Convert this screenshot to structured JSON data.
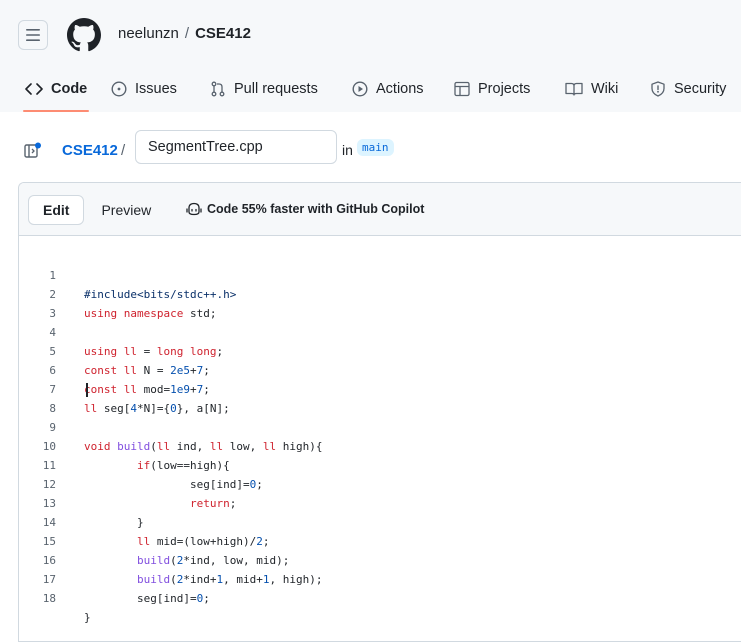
{
  "header": {
    "owner": "neelunzn",
    "separator": "/",
    "repo": "CSE412"
  },
  "tabs": [
    {
      "label": "Code",
      "icon": "code-icon",
      "selected": true
    },
    {
      "label": "Issues",
      "icon": "issue-opened-icon"
    },
    {
      "label": "Pull requests",
      "icon": "git-pull-request-icon"
    },
    {
      "label": "Actions",
      "icon": "play-icon"
    },
    {
      "label": "Projects",
      "icon": "table-icon"
    },
    {
      "label": "Wiki",
      "icon": "book-icon"
    },
    {
      "label": "Security",
      "icon": "shield-icon"
    }
  ],
  "path": {
    "repo_link": "CSE412",
    "slash": "/",
    "filename": "SegmentTree.cpp",
    "in_label": "in",
    "branch": "main"
  },
  "editor": {
    "edit_label": "Edit",
    "preview_label": "Preview",
    "copilot_label": "Code 55% faster with GitHub Copilot",
    "lines": [
      {
        "n": "1",
        "text": "#include<bits/stdc++.h>"
      },
      {
        "n": "2",
        "text": "using namespace std;"
      },
      {
        "n": "3",
        "text": ""
      },
      {
        "n": "4",
        "text": "using ll = long long;"
      },
      {
        "n": "5",
        "text": "const ll N = 2e5+7;"
      },
      {
        "n": "6",
        "text": "const ll mod=1e9+7;"
      },
      {
        "n": "7",
        "text": "ll seg[4*N]={0}, a[N];"
      },
      {
        "n": "8",
        "text": ""
      },
      {
        "n": "9",
        "text": "void build(ll ind, ll low, ll high){"
      },
      {
        "n": "10",
        "text": "        if(low==high){"
      },
      {
        "n": "11",
        "text": "                seg[ind]=0;"
      },
      {
        "n": "12",
        "text": "                return;"
      },
      {
        "n": "13",
        "text": "        }"
      },
      {
        "n": "14",
        "text": "        ll mid=(low+high)/2;"
      },
      {
        "n": "15",
        "text": "        build(2*ind, low, mid);"
      },
      {
        "n": "16",
        "text": "        build(2*ind+1, mid+1, high);"
      },
      {
        "n": "17",
        "text": "        seg[ind]=0;"
      },
      {
        "n": "18",
        "text": "}"
      }
    ]
  },
  "colors": {
    "accent_underline": "#fd8c73",
    "link": "#0969da",
    "keyword": "#cf222e",
    "function": "#8250df",
    "number": "#0550ae"
  }
}
